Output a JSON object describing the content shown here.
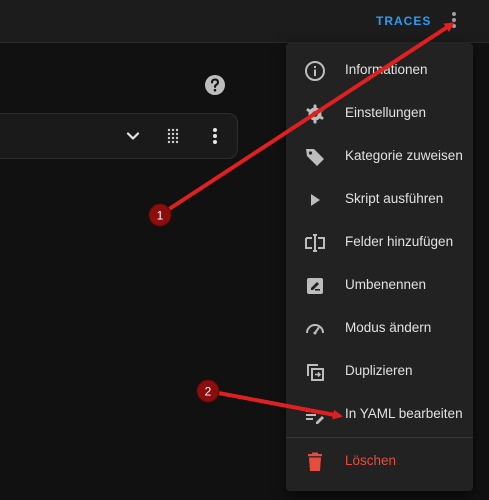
{
  "toolbar": {
    "traces_label": "TRACES",
    "overflow_icon": "dots-vertical-icon"
  },
  "help": {
    "icon": "help-circle-icon"
  },
  "row": {
    "icons": [
      "chevron-down-icon",
      "drag-grid-icon",
      "dots-vertical-icon"
    ]
  },
  "menu": {
    "items": [
      {
        "label": "Informationen",
        "icon": "info-icon"
      },
      {
        "label": "Einstellungen",
        "icon": "gear-icon"
      },
      {
        "label": "Kategorie zuweisen",
        "icon": "tag-icon"
      },
      {
        "label": "Skript ausführen",
        "icon": "play-icon"
      },
      {
        "label": "Felder hinzufügen",
        "icon": "form-textbox-icon"
      },
      {
        "label": "Umbenennen",
        "icon": "rename-icon"
      },
      {
        "label": "Modus ändern",
        "icon": "speedometer-icon"
      },
      {
        "label": "Duplizieren",
        "icon": "duplicate-icon"
      },
      {
        "label": "In YAML bearbeiten",
        "icon": "code-icon"
      },
      {
        "label": "Löschen",
        "icon": "delete-icon"
      }
    ]
  },
  "annotations": {
    "badges": [
      "1",
      "2"
    ],
    "badge_color": "#8b0d0d",
    "arrow_color": "#e02020"
  },
  "colors": {
    "accent": "#2a9df4",
    "danger": "#e84c3d",
    "menu_bg": "#222222",
    "page_bg": "#111111"
  }
}
